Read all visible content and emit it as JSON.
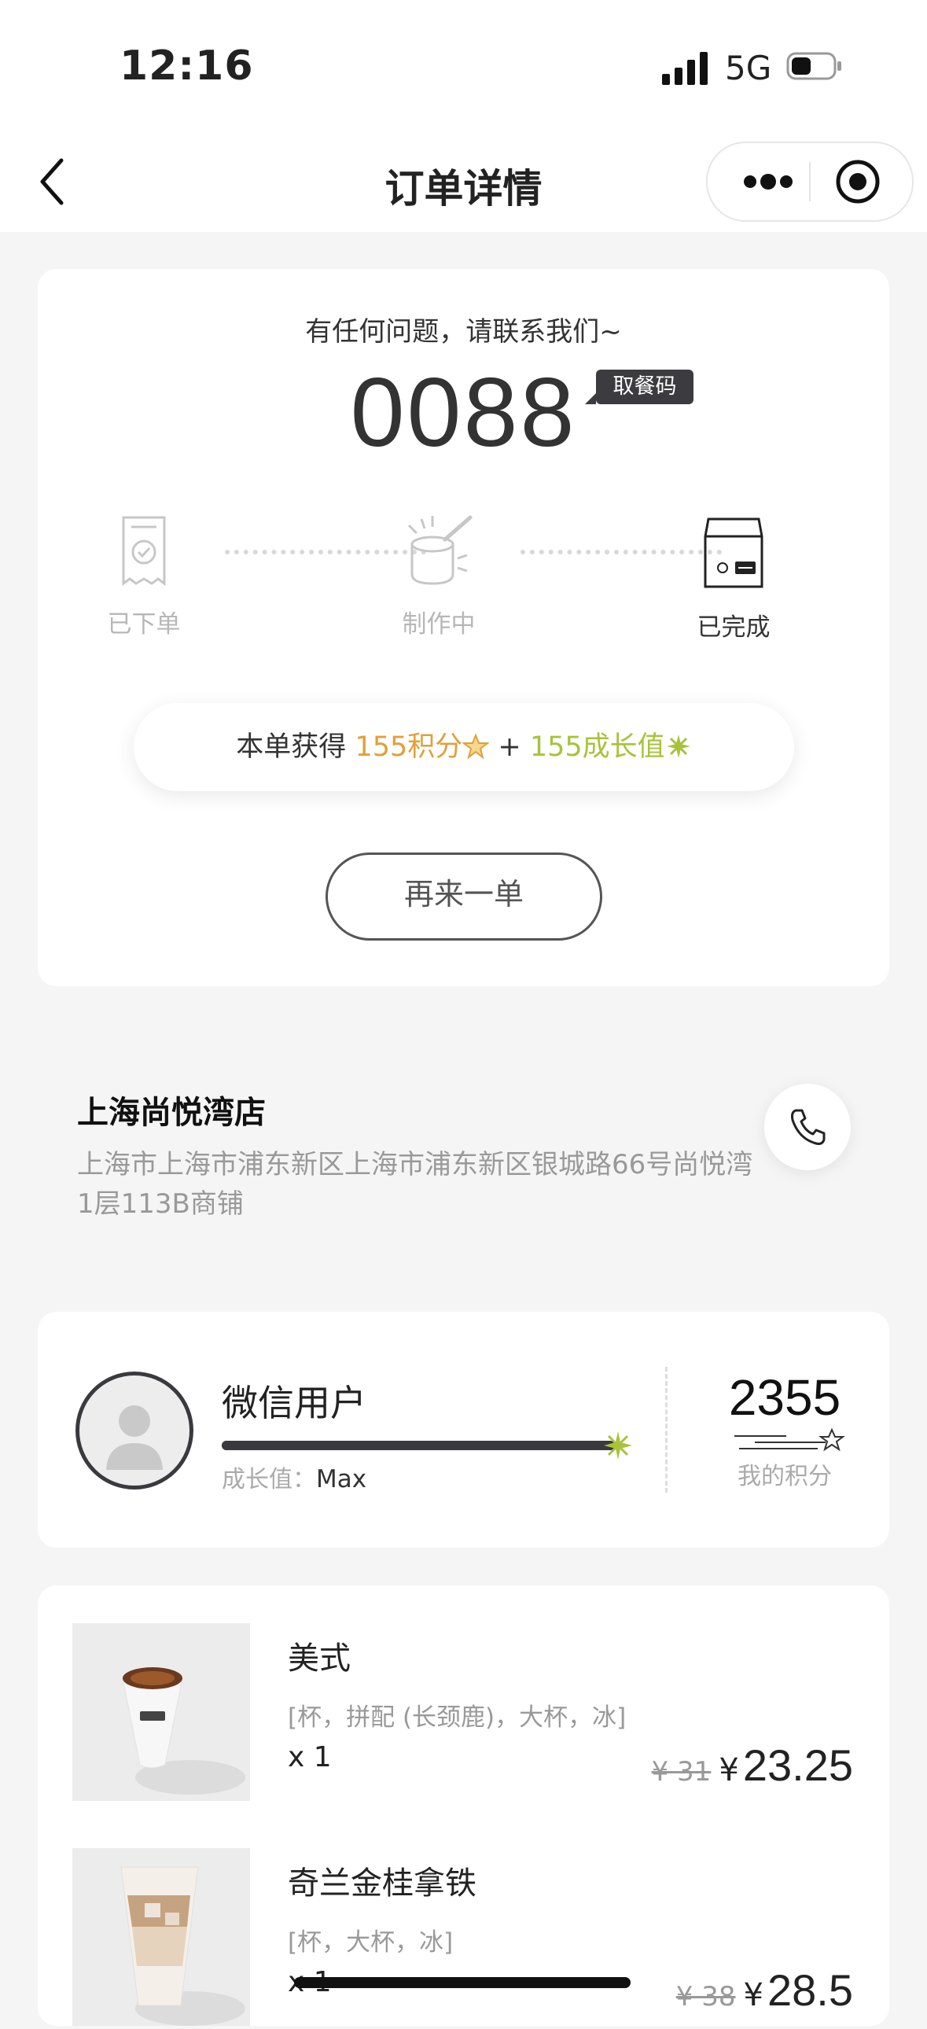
{
  "status_bar": {
    "time": "12:16",
    "network": "5G"
  },
  "nav": {
    "title": "订单详情"
  },
  "order": {
    "contact_text": "有任何问题，请联系我们~",
    "pickup_code": "0088",
    "pickup_code_tag": "取餐码",
    "steps": [
      {
        "label": "已下单",
        "state": "inactive"
      },
      {
        "label": "制作中",
        "state": "inactive"
      },
      {
        "label": "已完成",
        "state": "active"
      }
    ],
    "points_prefix": "本单获得",
    "points_earned": "155积分",
    "points_plus": "+",
    "growth_earned": "155成长值",
    "reorder_label": "再来一单"
  },
  "store": {
    "name": "上海尚悦湾店",
    "address": "上海市上海市浦东新区上海市浦东新区银城路66号尚悦湾1层113B商铺"
  },
  "member": {
    "username": "微信用户",
    "growth_label": "成长值：",
    "growth_value": "Max",
    "growth_progress": 1.0,
    "points": "2355",
    "points_label": "我的积分"
  },
  "items": [
    {
      "name": "美式",
      "options": "[杯，拼配 (长颈鹿)，大杯，冰]",
      "qty": "x 1",
      "original_price": "¥ 31",
      "currency": "¥",
      "price": "23.25"
    },
    {
      "name": "奇兰金桂拿铁",
      "options": "[杯，大杯，冰]",
      "qty": "x 1",
      "original_price": "¥ 38",
      "currency": "¥",
      "price": "28.5"
    }
  ],
  "colors": {
    "points": "#e0a03a",
    "growth": "#a9c23b",
    "dark": "#3a3a3e"
  }
}
